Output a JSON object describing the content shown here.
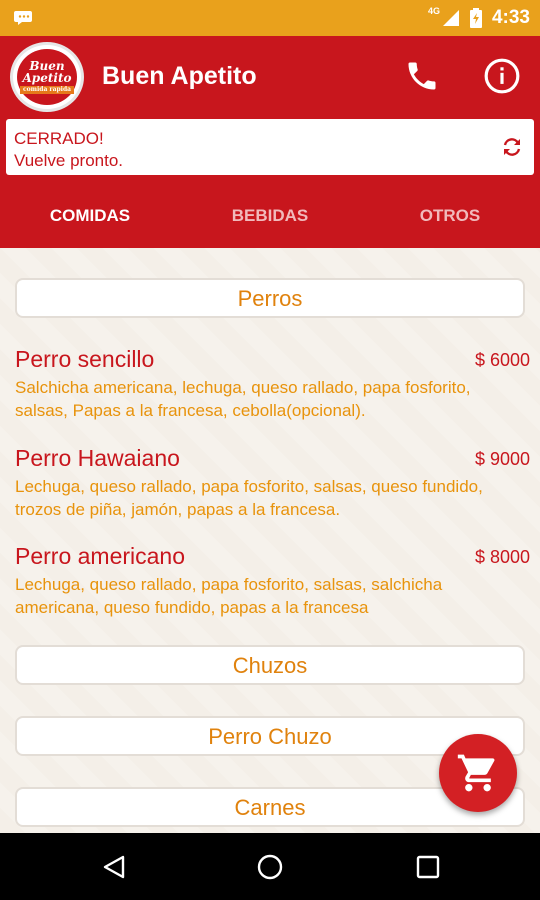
{
  "status_bar": {
    "time": "4:33",
    "network": "4G"
  },
  "app_bar": {
    "title": "Buen Apetito",
    "logo_text_1": "Buen",
    "logo_text_2": "Apetito",
    "logo_ribbon": "comida rapida"
  },
  "store_status": {
    "line1": "CERRADO!",
    "line2": "Vuelve pronto."
  },
  "tabs": [
    {
      "label": "COMIDAS",
      "active": true
    },
    {
      "label": "BEBIDAS",
      "active": false
    },
    {
      "label": "OTROS",
      "active": false
    }
  ],
  "categories": [
    {
      "label": "Perros"
    },
    {
      "label": "Chuzos"
    },
    {
      "label": "Perro Chuzo"
    },
    {
      "label": "Carnes"
    }
  ],
  "items": [
    {
      "name": "Perro sencillo",
      "price": "$ 6000",
      "description": "Salchicha americana, lechuga, queso rallado, papa fosforito, salsas, Papas a la francesa, cebolla(opcional)."
    },
    {
      "name": "Perro Hawaiano",
      "price": "$ 9000",
      "description": "Lechuga, queso rallado, papa fosforito, salsas, queso fundido, trozos de piña, jamón, papas a la francesa."
    },
    {
      "name": "Perro americano",
      "price": "$ 8000",
      "description": "Lechuga, queso rallado, papa fosforito, salsas, salchicha americana, queso fundido, papas a la francesa"
    }
  ],
  "colors": {
    "primary": "#c8161d",
    "status_bar": "#e9a11c",
    "accent_text": "#e8930c",
    "fab": "#d32024"
  },
  "icons": {
    "phone": "phone-icon",
    "info": "info-icon",
    "refresh": "refresh-icon",
    "cart": "cart-icon"
  }
}
